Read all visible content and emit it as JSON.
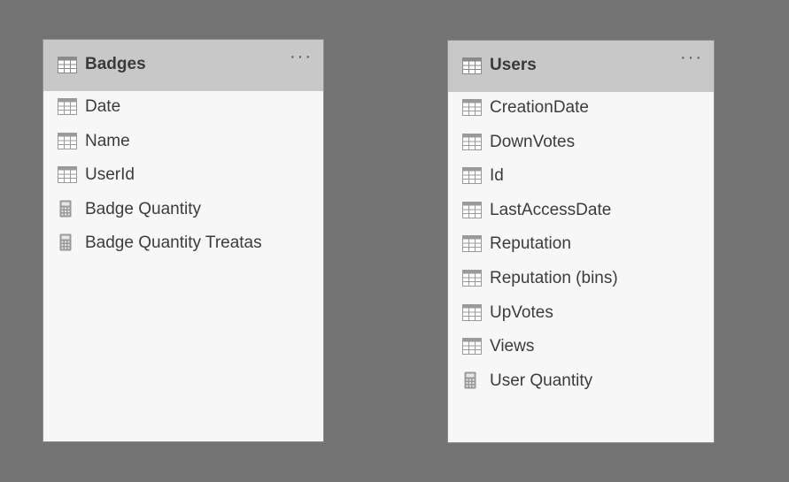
{
  "tables": [
    {
      "id": "badges",
      "name": "Badges",
      "more_label": "···",
      "fields": [
        {
          "label": "Date",
          "icon": "table-column-icon"
        },
        {
          "label": "Name",
          "icon": "table-column-icon"
        },
        {
          "label": "UserId",
          "icon": "table-column-icon"
        },
        {
          "label": "Badge Quantity",
          "icon": "calculator-icon"
        },
        {
          "label": "Badge Quantity Treatas",
          "icon": "calculator-icon"
        }
      ]
    },
    {
      "id": "users",
      "name": "Users",
      "more_label": "···",
      "fields": [
        {
          "label": "CreationDate",
          "icon": "table-column-icon"
        },
        {
          "label": "DownVotes",
          "icon": "table-column-icon"
        },
        {
          "label": "Id",
          "icon": "table-column-icon"
        },
        {
          "label": "LastAccessDate",
          "icon": "table-column-icon"
        },
        {
          "label": "Reputation",
          "icon": "table-column-icon"
        },
        {
          "label": "Reputation (bins)",
          "icon": "table-column-icon"
        },
        {
          "label": "UpVotes",
          "icon": "table-column-icon"
        },
        {
          "label": "Views",
          "icon": "table-column-icon"
        },
        {
          "label": "User Quantity",
          "icon": "calculator-icon"
        }
      ]
    }
  ],
  "colors": {
    "canvas": "#737373",
    "card_body": "#f7f7f7",
    "card_header": "#c8c8c8",
    "icon": "#9a9a9a",
    "text": "#3c3c3c"
  }
}
